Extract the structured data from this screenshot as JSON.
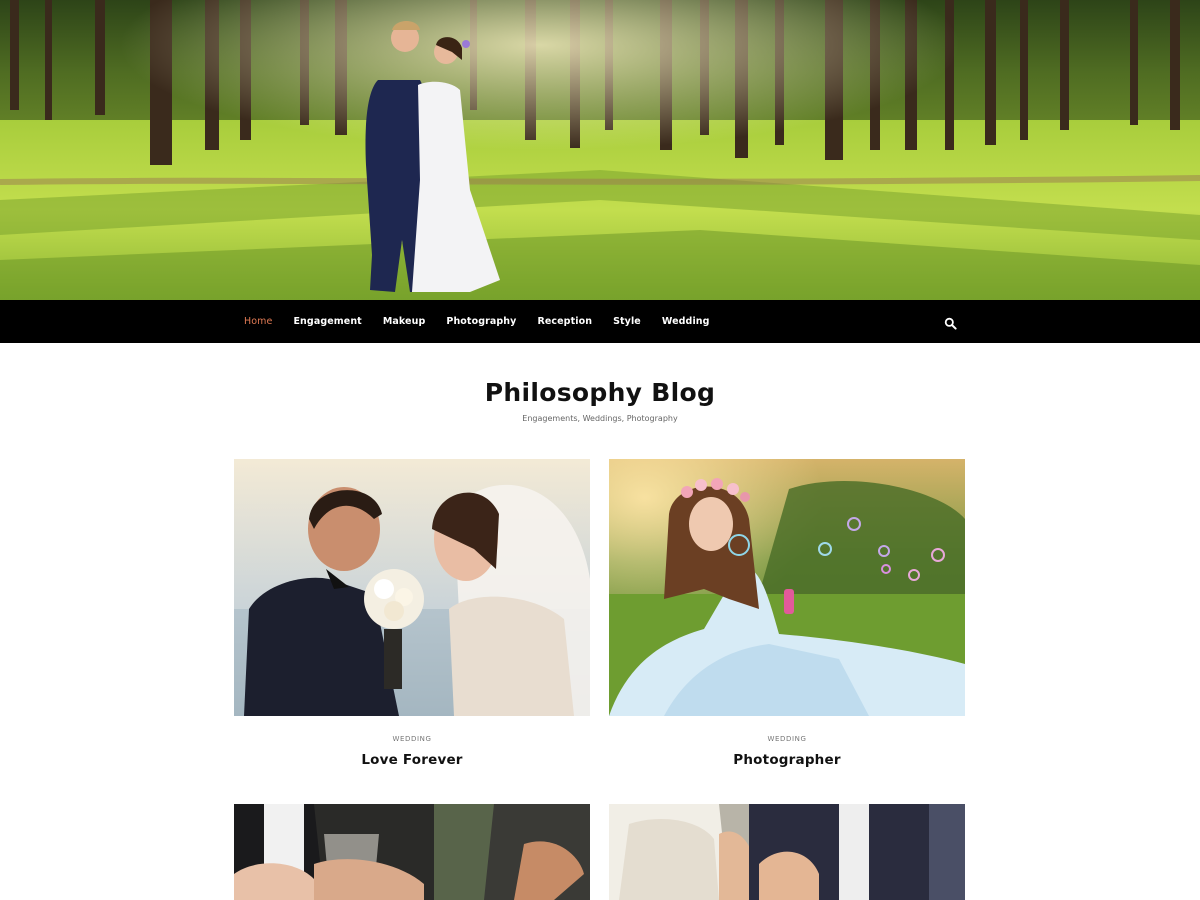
{
  "hero": {
    "image": "forest-wedding-couple-photo"
  },
  "nav": {
    "items": [
      {
        "label": "Home",
        "active": true
      },
      {
        "label": "Engagement"
      },
      {
        "label": "Makeup"
      },
      {
        "label": "Photography"
      },
      {
        "label": "Reception"
      },
      {
        "label": "Style"
      },
      {
        "label": "Wedding"
      }
    ],
    "search_icon": "search-icon",
    "active_color": "#e07a54"
  },
  "site": {
    "title": "Philosophy Blog",
    "tagline": "Engagements, Weddings, Photography"
  },
  "posts": [
    {
      "category": "WEDDING",
      "title": "Love Forever",
      "image": "couple-with-bouquet-photo"
    },
    {
      "category": "WEDDING",
      "title": "Photographer",
      "image": "bride-blowing-bubbles-photo"
    },
    {
      "image": "wine-glass-toast-photo"
    },
    {
      "image": "bride-and-groom-seated-photo"
    }
  ]
}
